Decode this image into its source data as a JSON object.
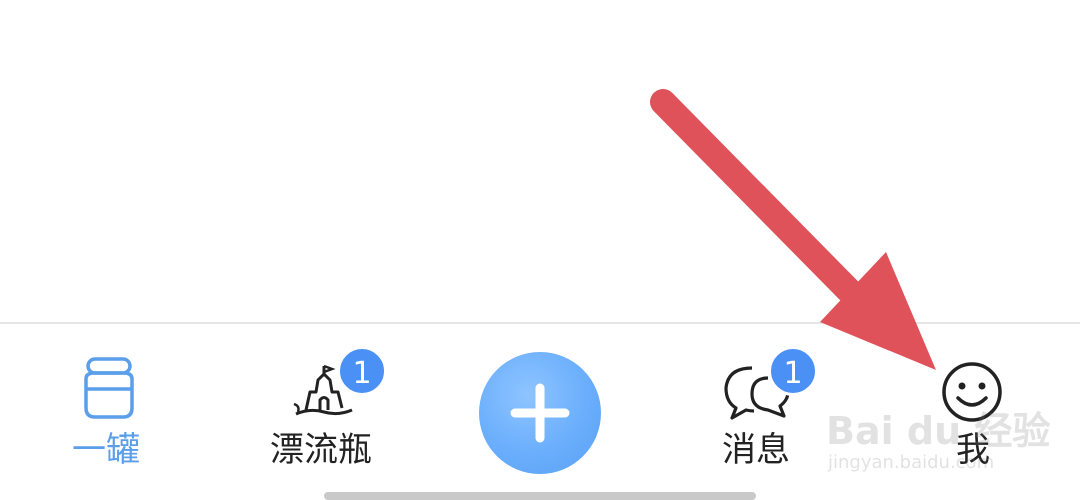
{
  "tabs": [
    {
      "label": "一罐",
      "icon": "jar-icon",
      "active": true,
      "badge": ""
    },
    {
      "label": "漂流瓶",
      "icon": "sandcastle-icon",
      "active": false,
      "badge": "1"
    },
    {
      "label": "",
      "icon": "plus-icon",
      "active": false,
      "badge": ""
    },
    {
      "label": "消息",
      "icon": "chat-bubbles-icon",
      "active": false,
      "badge": "1"
    },
    {
      "label": "我",
      "icon": "smiley-icon",
      "active": false,
      "badge": ""
    }
  ],
  "colors": {
    "active_tab": "#5b9ee9",
    "badge": "#4a90f5",
    "add_button": "#6aaefc",
    "annotation_arrow": "#e0525a"
  },
  "watermark": {
    "logo": "Bai du 经验",
    "url": "jingyan.baidu.com"
  }
}
